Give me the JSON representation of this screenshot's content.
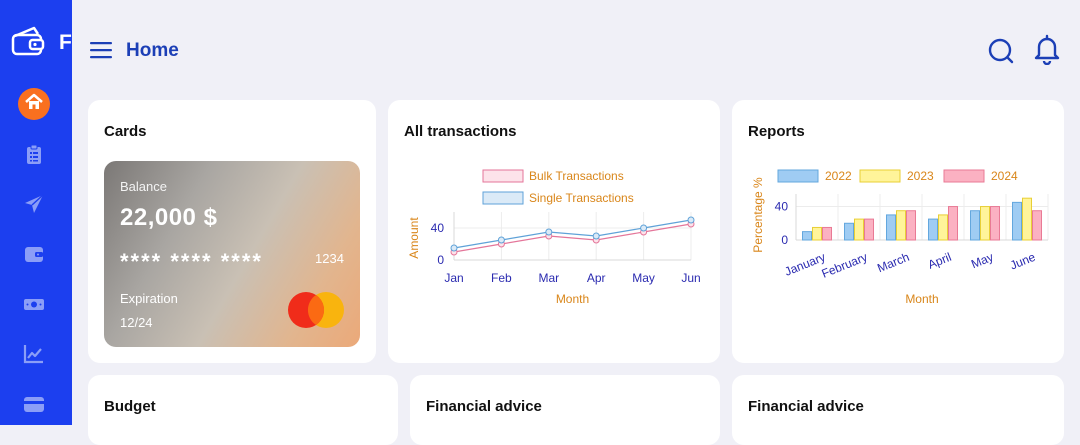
{
  "brand": {
    "letter": "F"
  },
  "header": {
    "title": "Home"
  },
  "cards_panel": {
    "title": "Cards",
    "balance_label": "Balance",
    "balance_value": "22,000 $",
    "masked_number": "**** **** ****",
    "last_digits": "1234",
    "expiration_label": "Expiration",
    "expiration_value": "12/24"
  },
  "transactions_panel": {
    "title": "All transactions",
    "chart_data": {
      "type": "line",
      "categories": [
        "Jan",
        "Feb",
        "Mar",
        "Apr",
        "May",
        "Jun"
      ],
      "series": [
        {
          "name": "Bulk Transactions",
          "values": [
            10,
            20,
            30,
            25,
            35,
            45
          ],
          "color": "#e4769a",
          "fill": "#fde3ea"
        },
        {
          "name": "Single Transactions",
          "values": [
            15,
            25,
            35,
            30,
            40,
            50
          ],
          "color": "#5fa2d8",
          "fill": "#dbeaf7"
        }
      ],
      "xlabel": "Month",
      "ylabel": "Amount",
      "yticks": [
        0,
        40
      ],
      "ylim": [
        0,
        60
      ]
    }
  },
  "reports_panel": {
    "title": "Reports",
    "chart_data": {
      "type": "bar",
      "categories": [
        "January",
        "February",
        "March",
        "April",
        "May",
        "June"
      ],
      "series": [
        {
          "name": "2022",
          "values": [
            10,
            20,
            30,
            25,
            35,
            45
          ],
          "color": "#9fccf3",
          "stroke": "#63a7de"
        },
        {
          "name": "2023",
          "values": [
            15,
            25,
            35,
            30,
            40,
            50
          ],
          "color": "#fff49a",
          "stroke": "#e8cf35"
        },
        {
          "name": "2024",
          "values": [
            15,
            25,
            35,
            40,
            40,
            35
          ],
          "color": "#fbb1c2",
          "stroke": "#e97a95"
        }
      ],
      "xlabel": "Month",
      "ylabel": "Percentage %",
      "yticks": [
        0,
        40
      ],
      "ylim": [
        0,
        55
      ]
    }
  },
  "budget_panel": {
    "title": "Budget"
  },
  "advice_panel_1": {
    "title": "Financial advice"
  },
  "advice_panel_2": {
    "title": "Financial advice"
  },
  "colors": {
    "sidebar": "#1c3fef",
    "accent_orange": "#f9701f",
    "header_text": "#1c3fb6",
    "axis_label": "#d9861a",
    "tick_label": "#2b2bb0"
  },
  "icons": {
    "brand": "wallet-icon",
    "home": "home-icon",
    "clipboard": "clipboard-icon",
    "send": "paper-plane-icon",
    "wallet": "wallet-icon",
    "money": "money-icon",
    "chart": "trend-chart-icon",
    "card": "credit-card-icon",
    "search": "search-icon",
    "bell": "bell-icon",
    "menu": "hamburger-menu-icon"
  }
}
